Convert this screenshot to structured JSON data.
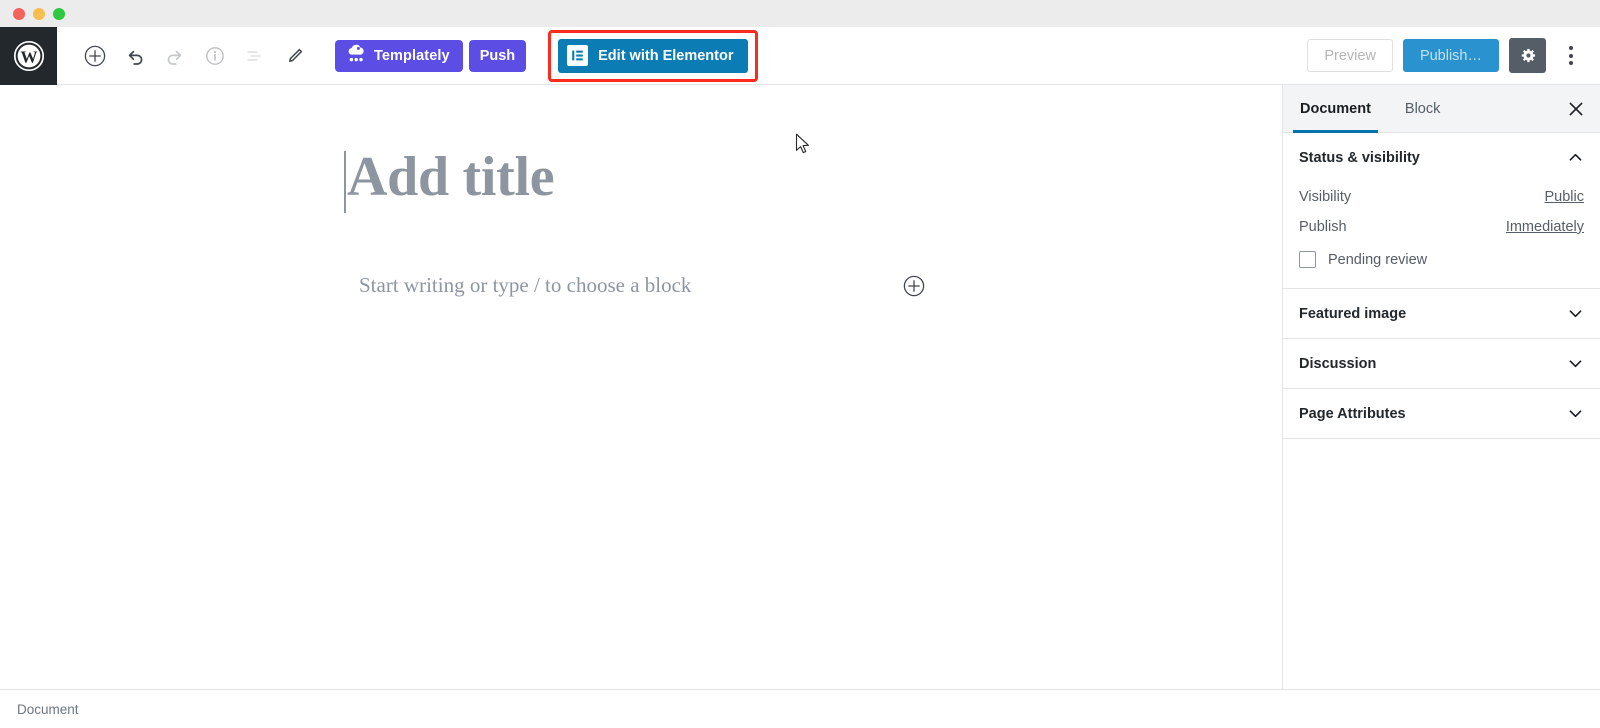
{
  "window": {
    "traffic_lights": [
      {
        "name": "close",
        "color": "#f4625c"
      },
      {
        "name": "minimize",
        "color": "#f7bd4f"
      },
      {
        "name": "zoom",
        "color": "#2fc840"
      }
    ]
  },
  "toolbar": {
    "logo_label": "WordPress",
    "icons": [
      {
        "name": "add-block-icon",
        "title": "Add block"
      },
      {
        "name": "undo-icon",
        "title": "Undo"
      },
      {
        "name": "redo-icon",
        "title": "Redo"
      },
      {
        "name": "info-icon",
        "title": "Content structure"
      },
      {
        "name": "block-navigation-icon",
        "title": "Block navigation"
      },
      {
        "name": "edit-pencil-icon",
        "title": "Edit"
      }
    ],
    "templately_label": "Templately",
    "push_label": "Push",
    "elementor_label": "Edit with Elementor",
    "preview_label": "Preview",
    "publish_label": "Publish…",
    "settings_title": "Settings",
    "more_title": "More tools & options",
    "accent_elementor": "#0c7cb5",
    "accent_templately": "#5c4ee5",
    "accent_publish": "#2a93cf",
    "highlight_color": "#fb2c1f"
  },
  "canvas": {
    "title_placeholder": "Add title",
    "paragraph_placeholder": "Start writing or type / to choose a block",
    "inserter_title": "Add block"
  },
  "sidebar": {
    "tabs": [
      {
        "label": "Document",
        "active": true
      },
      {
        "label": "Block",
        "active": false
      }
    ],
    "close_title": "Close settings",
    "panels": [
      {
        "title": "Status & visibility",
        "expanded": true,
        "rows": [
          {
            "label": "Visibility",
            "value": "Public"
          },
          {
            "label": "Publish",
            "value": "Immediately"
          }
        ],
        "checkbox": {
          "label": "Pending review",
          "checked": false
        }
      },
      {
        "title": "Featured image",
        "expanded": false
      },
      {
        "title": "Discussion",
        "expanded": false
      },
      {
        "title": "Page Attributes",
        "expanded": false
      }
    ]
  },
  "breadcrumb": {
    "items": [
      "Document"
    ]
  }
}
